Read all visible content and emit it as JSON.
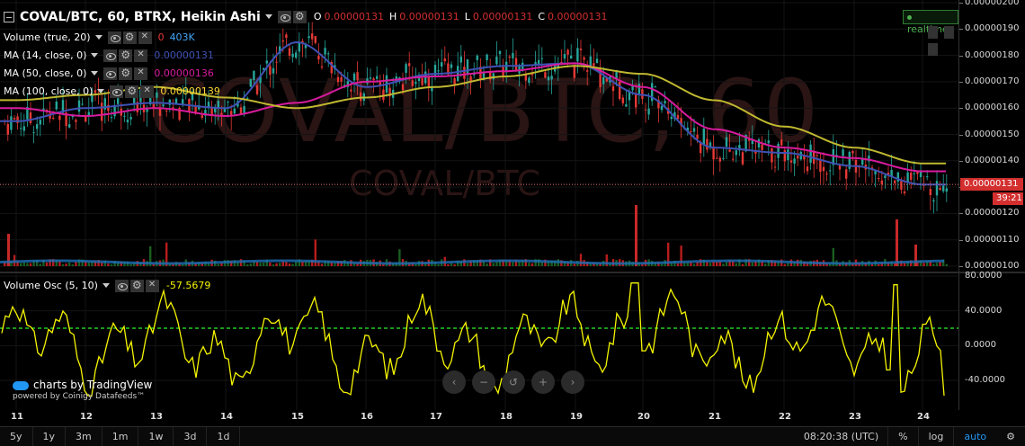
{
  "header": {
    "title": "COVAL/BTC, 60, BTRX, Heikin Ashi",
    "ohlc": [
      {
        "key": "O",
        "value": "0.00000131"
      },
      {
        "key": "H",
        "value": "0.00000131"
      },
      {
        "key": "L",
        "value": "0.00000131"
      },
      {
        "key": "C",
        "value": "0.00000131"
      }
    ],
    "realtime_label": "realtime"
  },
  "studies": [
    {
      "label": "Volume (true, 20)",
      "values": [
        {
          "text": "0",
          "color": "#e53935"
        },
        {
          "text": "403K",
          "color": "#42a5f5"
        }
      ]
    },
    {
      "label": "MA (14, close, 0)",
      "values": [
        {
          "text": "0.00000131",
          "color": "#3f51b5"
        }
      ]
    },
    {
      "label": "MA (50, close, 0)",
      "values": [
        {
          "text": "0.00000136",
          "color": "#d81b9e"
        }
      ]
    },
    {
      "label": "MA (100, close, 0)",
      "values": [
        {
          "text": "0.00000139",
          "color": "#fdd835"
        }
      ]
    }
  ],
  "watermark": {
    "main": "COVAL/BTC, 60",
    "sub": "COVAL/BTC"
  },
  "price_axis": {
    "labels": [
      "0.00000200",
      "0.00000190",
      "0.00000180",
      "0.00000170",
      "0.00000160",
      "0.00000150",
      "0.00000140",
      "0.00000130",
      "0.00000120",
      "0.00000110",
      "0.00000100"
    ],
    "current_price": "0.00000131",
    "countdown": "39:21"
  },
  "oscillator": {
    "label": "Volume Osc (5, 10)",
    "value": "-57.5679",
    "axis_labels": [
      "80.0000",
      "40.0000",
      "0.0000",
      "-40.0000"
    ]
  },
  "time_axis": {
    "labels": [
      "11",
      "12",
      "13",
      "14",
      "15",
      "16",
      "17",
      "18",
      "19",
      "20",
      "21",
      "22",
      "23",
      "24"
    ]
  },
  "branding": {
    "line1": "charts by TradingView",
    "line2": "powered by Coinigy Datafeeds™"
  },
  "nav_buttons": [
    "‹",
    "−",
    "↺",
    "+",
    "›"
  ],
  "toolbar": {
    "ranges": [
      "5y",
      "1y",
      "3m",
      "1m",
      "1w",
      "3d",
      "1d"
    ],
    "clock": "08:20:38 (UTC)",
    "percent": "%",
    "log": "log",
    "auto": "auto"
  },
  "colors": {
    "up": "#26a69a",
    "down": "#e53935",
    "ma14": "#3f51b5",
    "ma50": "#d81b9e",
    "ma100": "#c0b830",
    "osc": "#f5f500",
    "osc_zero_line": "#22cc22",
    "price_line": "#e57373"
  },
  "chart_data": [
    {
      "type": "line",
      "title": "COVAL/BTC, 60, BTRX, Heikin Ashi",
      "x": [
        "11",
        "12",
        "13",
        "14",
        "15",
        "16",
        "17",
        "18",
        "19",
        "20",
        "21",
        "22",
        "23",
        "24"
      ],
      "ylim": [
        1e-06,
        2e-06
      ],
      "series": [
        {
          "name": "MA (14, close, 0)",
          "values": [
            1.55e-06,
            1.6e-06,
            1.62e-06,
            1.6e-06,
            1.85e-06,
            1.68e-06,
            1.73e-06,
            1.76e-06,
            1.77e-06,
            1.65e-06,
            1.45e-06,
            1.43e-06,
            1.38e-06,
            1.31e-06
          ]
        },
        {
          "name": "MA (50, close, 0)",
          "values": [
            1.6e-06,
            1.57e-06,
            1.6e-06,
            1.57e-06,
            1.62e-06,
            1.7e-06,
            1.72e-06,
            1.74e-06,
            1.77e-06,
            1.68e-06,
            1.52e-06,
            1.45e-06,
            1.41e-06,
            1.36e-06
          ]
        },
        {
          "name": "MA (100, close, 0)",
          "values": [
            1.63e-06,
            1.65e-06,
            1.68e-06,
            1.64e-06,
            1.6e-06,
            1.64e-06,
            1.68e-06,
            1.72e-06,
            1.76e-06,
            1.73e-06,
            1.63e-06,
            1.53e-06,
            1.45e-06,
            1.39e-06
          ]
        }
      ]
    },
    {
      "type": "line",
      "title": "Volume Osc (5, 10)",
      "x": [
        "11",
        "12",
        "13",
        "14",
        "15",
        "16",
        "17",
        "18",
        "19",
        "20",
        "21",
        "22",
        "23",
        "24"
      ],
      "ylim": [
        -50,
        80
      ],
      "series": [
        {
          "name": "Volume Osc (5, 10)",
          "values": [
            20,
            5,
            10,
            -10,
            25,
            -20,
            20,
            -15,
            25,
            70,
            -15,
            15,
            20,
            -57.5679
          ]
        }
      ]
    }
  ]
}
